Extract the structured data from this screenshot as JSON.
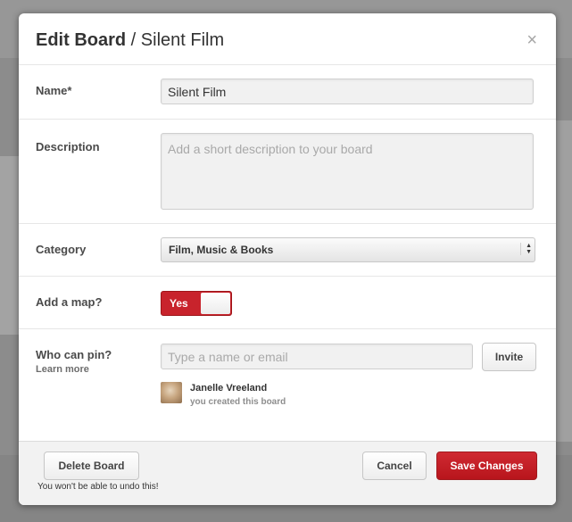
{
  "modal": {
    "title_bold": "Edit Board",
    "title_rest": " / Silent Film",
    "close": "×"
  },
  "form": {
    "name": {
      "label": "Name*",
      "value": "Silent Film"
    },
    "description": {
      "label": "Description",
      "placeholder": "Add a short description to your board"
    },
    "category": {
      "label": "Category",
      "selected": "Film, Music & Books"
    },
    "map": {
      "label": "Add a map?",
      "toggle_label": "Yes",
      "enabled": true
    },
    "collaborators": {
      "label": "Who can pin?",
      "learn_more": "Learn more",
      "placeholder": "Type a name or email",
      "invite_label": "Invite",
      "pinner": {
        "name": "Janelle Vreeland",
        "note": "you created this board"
      }
    }
  },
  "footer": {
    "delete_label": "Delete Board",
    "delete_note": "You won't be able to undo this!",
    "cancel_label": "Cancel",
    "save_label": "Save Changes"
  },
  "colors": {
    "accent": "#c8232c",
    "overlay": "#8c8c8c"
  }
}
